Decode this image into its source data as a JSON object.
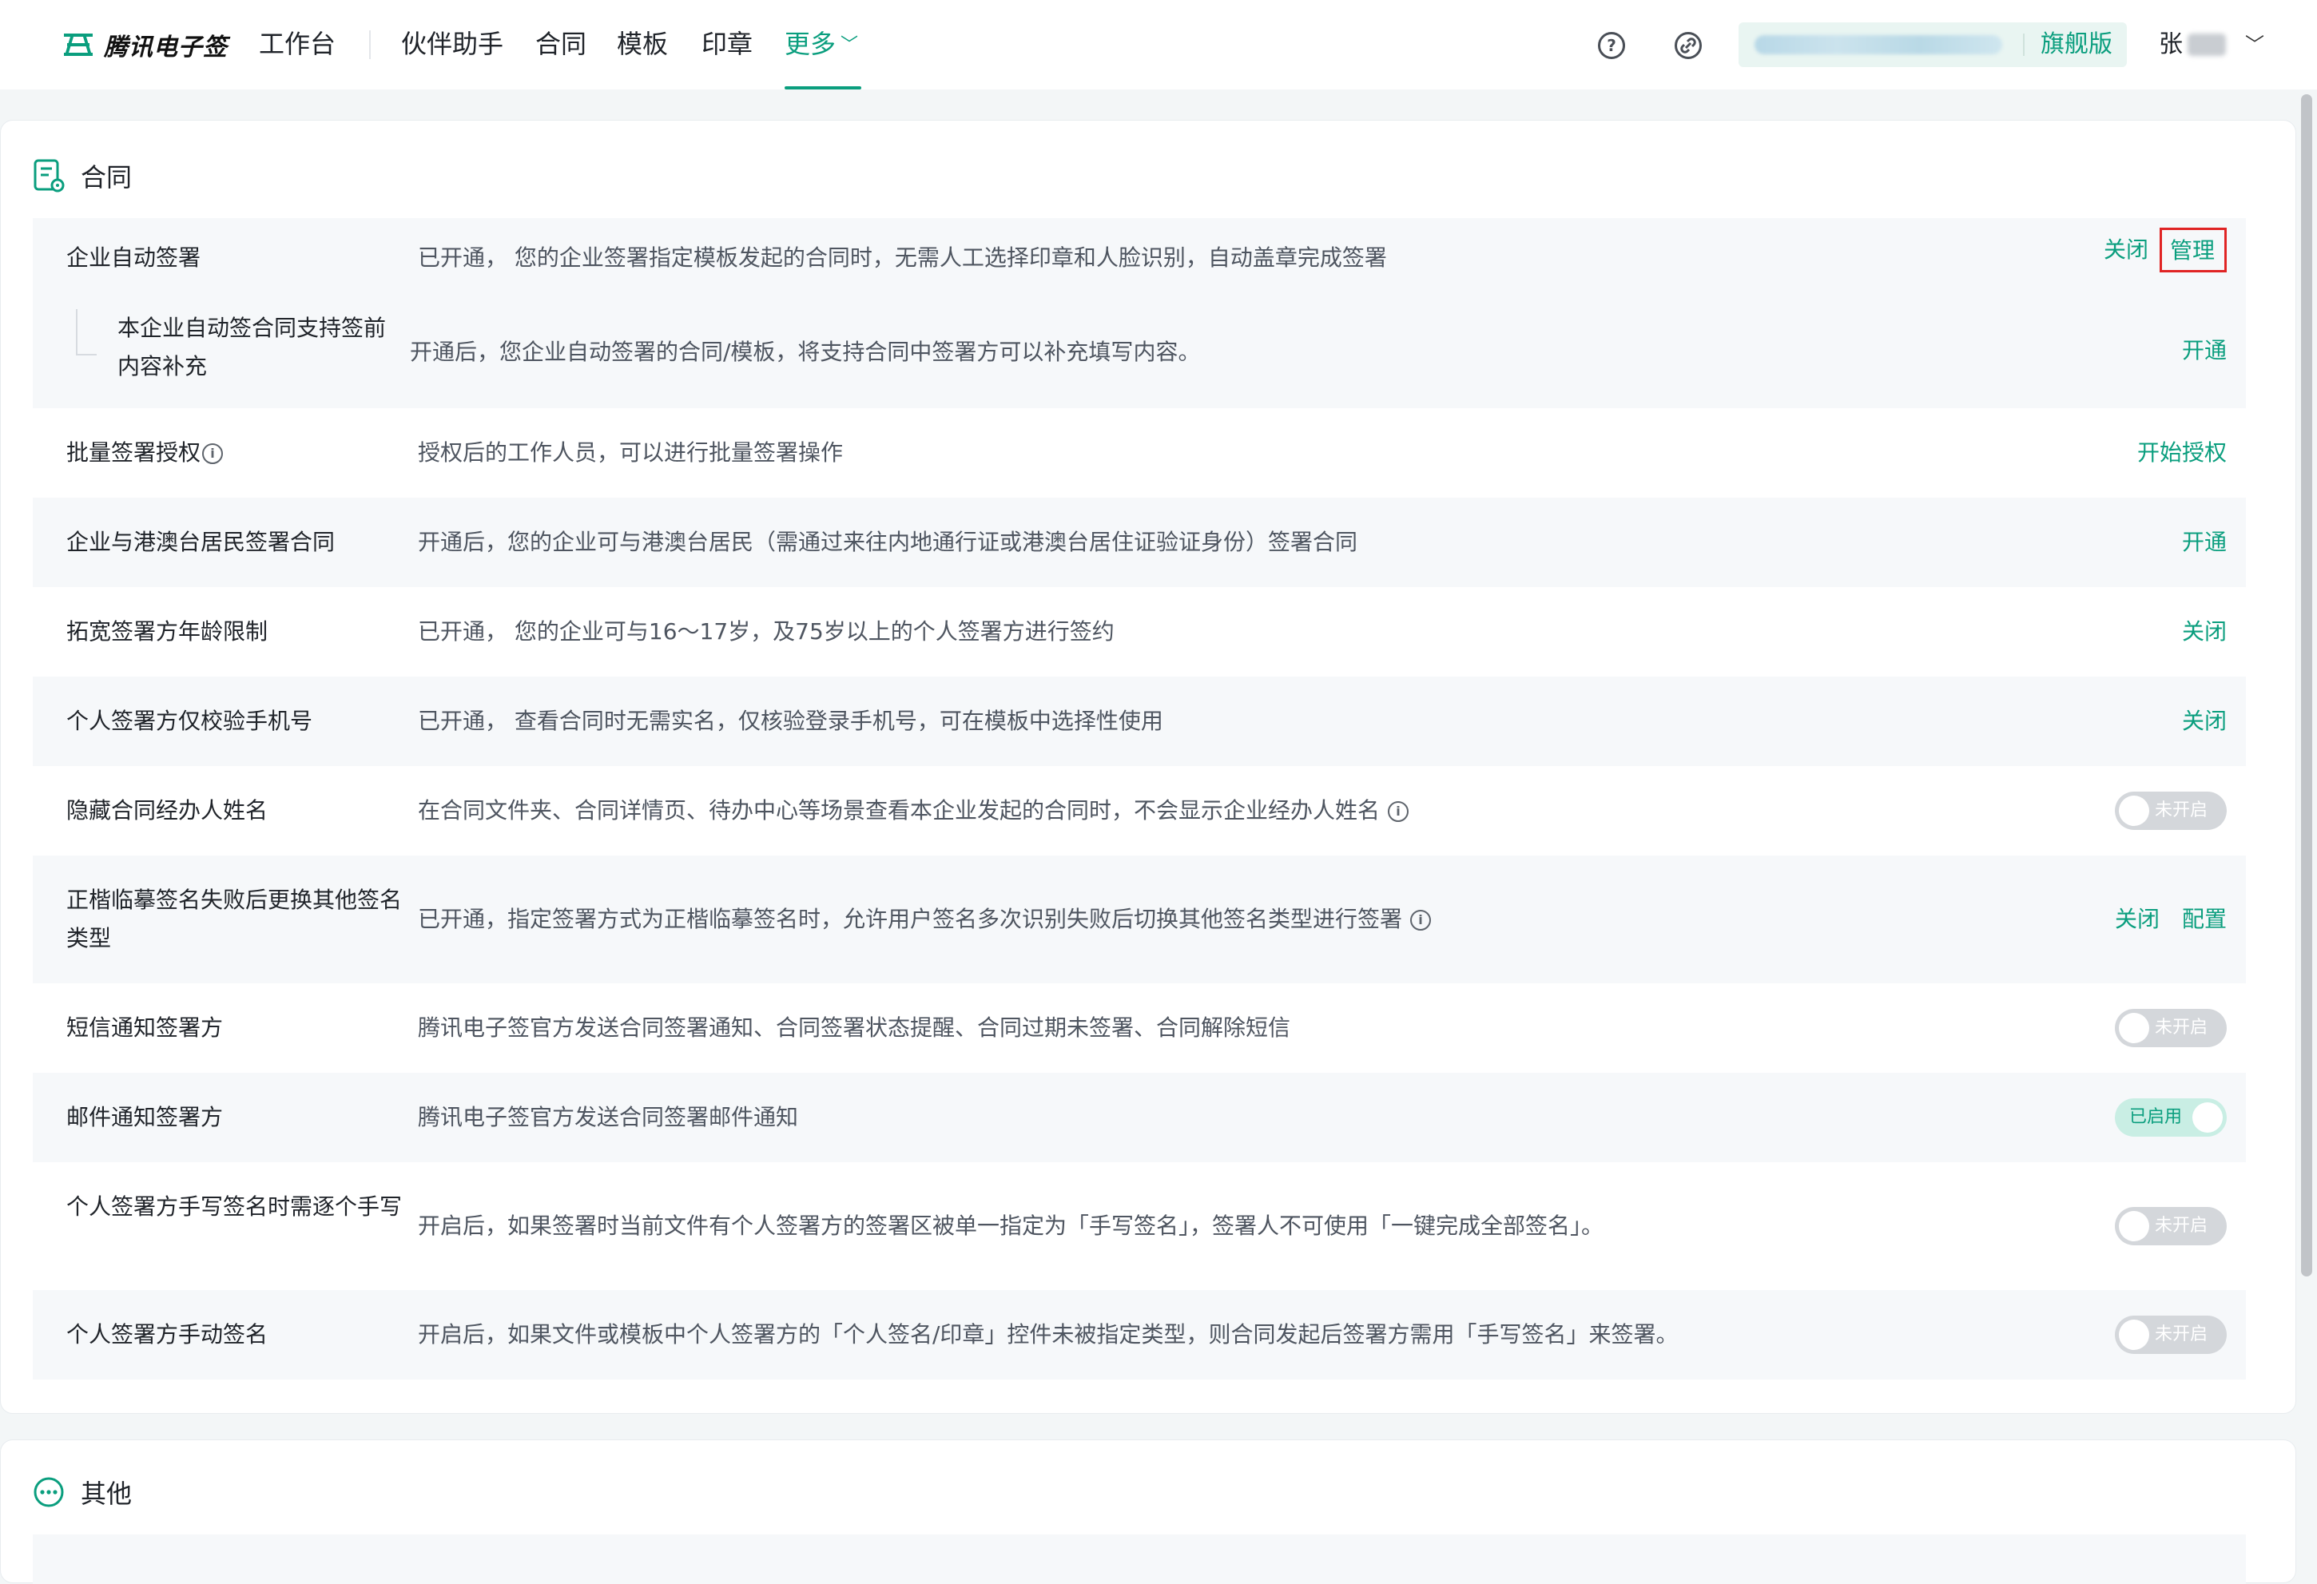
{
  "brand": {
    "name": "腾讯电子签"
  },
  "nav": {
    "workbench": "工作台",
    "items": [
      "伙伴助手",
      "合同",
      "模板",
      "印章"
    ],
    "more": "更多"
  },
  "header": {
    "help_icon": "question-circle-icon",
    "link_icon": "link-circle-icon",
    "edition": "旗舰版",
    "user_initial": "张"
  },
  "contract_section": {
    "title": "合同",
    "rows": [
      {
        "name": "企业自动签署",
        "desc": "已开通， 您的企业签署指定模板发起的合同时，无需人工选择印章和人脸识别，自动盖章完成签署",
        "actions": [
          "关闭",
          "管理"
        ]
      },
      {
        "name": "本企业自动签合同支持签前内容补充",
        "desc": "开通后，您企业自动签署的合同/模板，将支持合同中签署方可以补充填写内容。",
        "actions": [
          "开通"
        ]
      },
      {
        "name": "批量签署授权",
        "desc": "授权后的工作人员，可以进行批量签署操作",
        "actions": [
          "开始授权"
        ]
      },
      {
        "name": "企业与港澳台居民签署合同",
        "desc": "开通后，您的企业可与港澳台居民（需通过来往内地通行证或港澳台居住证验证身份）签署合同",
        "actions": [
          "开通"
        ]
      },
      {
        "name": "拓宽签署方年龄限制",
        "desc": "已开通， 您的企业可与16～17岁，及75岁以上的个人签署方进行签约",
        "actions": [
          "关闭"
        ]
      },
      {
        "name": "个人签署方仅校验手机号",
        "desc": "已开通， 查看合同时无需实名，仅核验登录手机号，可在模板中选择性使用",
        "actions": [
          "关闭"
        ]
      },
      {
        "name": "隐藏合同经办人姓名",
        "desc": "在合同文件夹、合同详情页、待办中心等场景查看本企业发起的合同时，不会显示企业经办人姓名",
        "toggle": "未开启"
      },
      {
        "name": "正楷临摹签名失败后更换其他签名类型",
        "desc": "已开通，指定签署方式为正楷临摹签名时，允许用户签名多次识别失败后切换其他签名类型进行签署",
        "actions": [
          "关闭",
          "配置"
        ]
      },
      {
        "name": "短信通知签署方",
        "desc": "腾讯电子签官方发送合同签署通知、合同签署状态提醒、合同过期未签署、合同解除短信",
        "toggle": "未开启"
      },
      {
        "name": "邮件通知签署方",
        "desc": "腾讯电子签官方发送合同签署邮件通知",
        "toggle": "已启用"
      },
      {
        "name": "个人签署方手写签名时需逐个手写",
        "desc": "开启后，如果签署时当前文件有个人签署方的签署区被单一指定为「手写签名」，签署人不可使用「一键完成全部签名」。",
        "toggle": "未开启"
      },
      {
        "name": "个人签署方手动签名",
        "desc": "开启后，如果文件或模板中个人签署方的「个人签名/印章」控件未被指定类型，则合同发起后签署方需用「手写签名」来签署。",
        "toggle": "未开启"
      }
    ]
  },
  "other_section": {
    "title": "其他"
  },
  "colors": {
    "brand": "#0a9e7e",
    "highlight_box": "#e02424"
  }
}
